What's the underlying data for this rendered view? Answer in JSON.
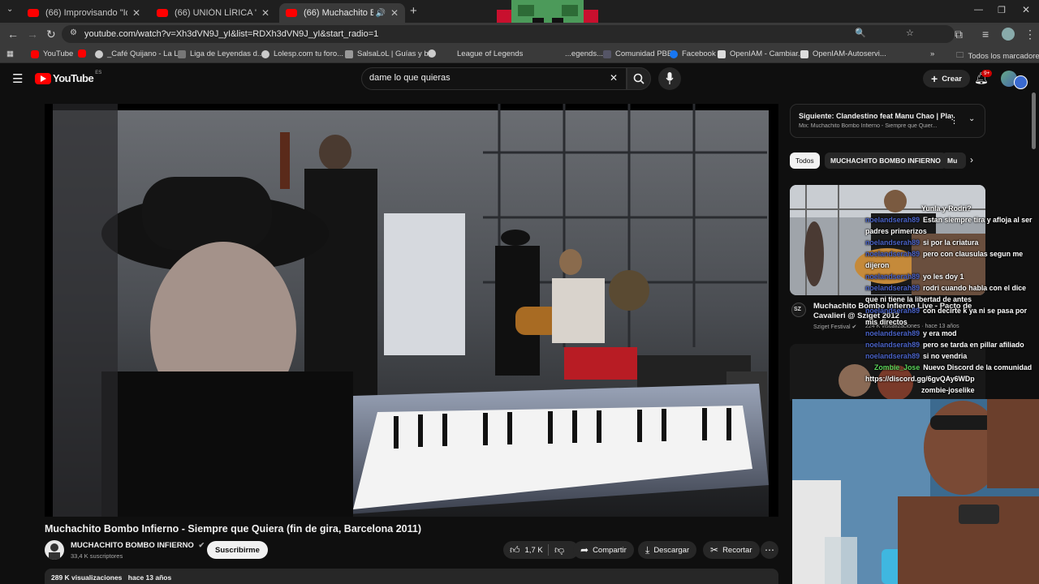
{
  "browser": {
    "tabs": [
      {
        "title": "(66) Improvisando \"Idilio\" en La",
        "active": false
      },
      {
        "title": "(66) UNIÓN LÍRICA \" Sin parar\"",
        "active": false
      },
      {
        "title": "(66) Muchachito Bombo Inf",
        "active": true
      }
    ],
    "url": "youtube.com/watch?v=Xh3dVN9J_yI&list=RDXh3dVN9J_yI&start_radio=1",
    "bookmarks": [
      "YouTube",
      "_Café Quijano - La L...",
      "Liga de Leyendas d...",
      "Lolesp.com tu foro...",
      "SalsaLoL | Guías y b...",
      "League of Legends",
      "...egends...",
      "Comunidad PBE",
      "Facebook",
      "OpenIAM - Cambiar...",
      "OpenIAM-Autoservi..."
    ],
    "all_bookmarks_label": "Todos los marcadores"
  },
  "youtube": {
    "logo_text": "YouTube",
    "logo_region": "ES",
    "search_value": "dame lo que quieras",
    "create_label": "Crear",
    "notifications_badge": "9+",
    "video": {
      "title": "Muchachito Bombo Infierno - Siempre que Quiera (fin de gira, Barcelona 2011)",
      "channel": "MUCHACHITO BOMBO INFIERNO",
      "subscribers": "33,4 K suscriptores",
      "subscribe_label": "Suscribirme",
      "likes": "1,7 K",
      "share_label": "Compartir",
      "download_label": "Descargar",
      "clip_label": "Recortar",
      "views": "289 K visualizaciones",
      "age": "hace 13 años"
    },
    "next": {
      "label": "Siguiente: Clandestino feat Manu Chao | Play...",
      "sub": "Mix: Muchachito Bombo Infierno - Siempre que Quier..."
    },
    "chips": [
      "Todos",
      "MUCHACHITO BOMBO INFIERNO",
      "Mu"
    ],
    "recommended": {
      "title": "Muchachito Bombo Infierno Live - Pacto de Cavalieri @ Sziget 2012",
      "channel": "Sziget Festival",
      "meta": "224 K visualizaciones · hace 13 años",
      "channel_avatar": "SZ"
    }
  },
  "chat": [
    {
      "user": "",
      "msg": "Yunla y Rodri?"
    },
    {
      "user": "noelandserah89",
      "msg": "Estan siempre tira y afloja al ser padres primerizos"
    },
    {
      "user": "noelandserah89",
      "msg": "si por la criatura"
    },
    {
      "user": "noelandserah89",
      "msg": "pero con clausulas segun me dijeron"
    },
    {
      "user": "noelandserah89",
      "msg": "yo les doy 1"
    },
    {
      "user": "noelandserah89",
      "msg": "rodri cuando habla con el dice que ni tiene la libertad de antes"
    },
    {
      "user": "noelandserah89",
      "msg": "con decirte k ya ni se pasa por mis directos"
    },
    {
      "user": "noelandserah89",
      "msg": "y era mod"
    },
    {
      "user": "noelandserah89",
      "msg": "pero se tarda en pillar afiliado"
    },
    {
      "user": "noelandserah89",
      "msg": "si no vendria"
    },
    {
      "user": "Zombie_Jose",
      "msg": "Nuevo Discord de la comunidad https://discord.gg/6gvQAy6WDp"
    },
    {
      "user": "",
      "msg": "zombie-joselike"
    }
  ],
  "colors": {
    "yt_red": "#ff0000",
    "bg": "#0f0f0f",
    "chip_bg": "#272727",
    "chat_user": "#4a63c8",
    "chat_user_green": "#5bd65b"
  }
}
